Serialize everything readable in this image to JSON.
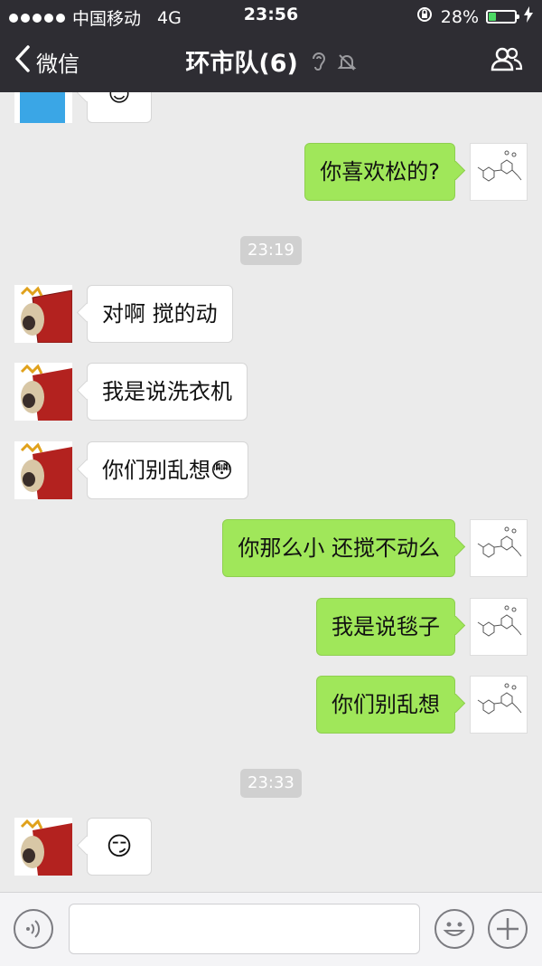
{
  "status_bar": {
    "carrier": "中国移动",
    "network": "4G",
    "time": "23:56",
    "battery_percent": "28%",
    "battery_level": 0.28,
    "battery_color": "#4cd964"
  },
  "nav": {
    "back_label": "微信",
    "title": "环市队(6)",
    "icons": [
      "ear-icon",
      "mute-bell-icon",
      "group-members-icon",
      "back-chevron-icon"
    ]
  },
  "messages": [
    {
      "side": "in",
      "type": "emoji",
      "emoji": "😊"
    },
    {
      "side": "out",
      "type": "text",
      "text": "你喜欢松的?"
    },
    {
      "type": "timestamp",
      "text": "23:19"
    },
    {
      "side": "in",
      "type": "text",
      "text": "对啊 搅的动"
    },
    {
      "side": "in",
      "type": "text",
      "text": "我是说洗衣机"
    },
    {
      "side": "in",
      "type": "text",
      "text": "你们别乱想😳"
    },
    {
      "side": "out",
      "type": "text",
      "text": "你那么小 还搅不动么"
    },
    {
      "side": "out",
      "type": "text",
      "text": "我是说毯子"
    },
    {
      "side": "out",
      "type": "text",
      "text": "你们别乱想"
    },
    {
      "type": "timestamp",
      "text": "23:33"
    },
    {
      "side": "in",
      "type": "emoji",
      "emoji": "😏"
    }
  ],
  "input_bar": {
    "value": "",
    "icons": [
      "voice-icon",
      "emoji-icon",
      "plus-icon"
    ]
  },
  "colors": {
    "topbar": "#2e2d33",
    "chat_bg": "#ebebeb",
    "outgoing_bubble": "#a0e75a",
    "incoming_bubble": "#ffffff",
    "timestamp_bg": "#d0d0d0"
  }
}
